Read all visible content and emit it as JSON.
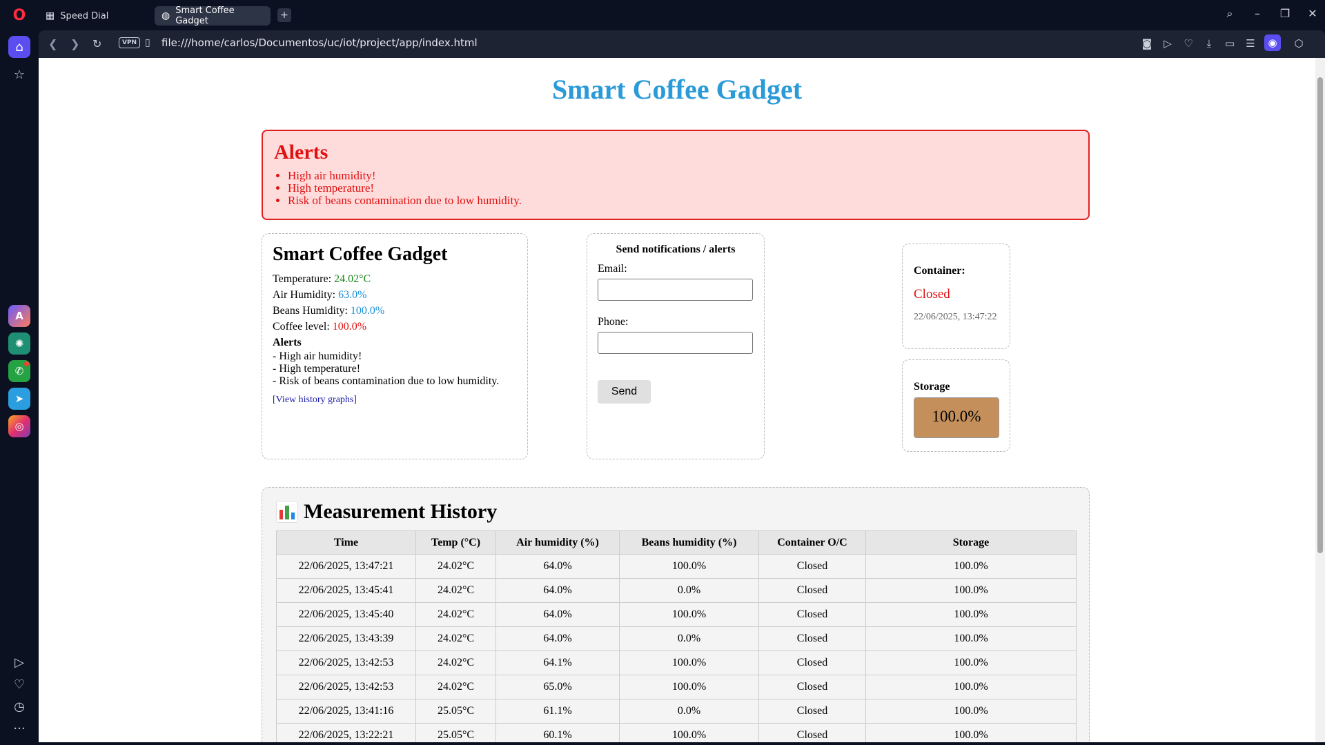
{
  "browser": {
    "tabs": [
      {
        "label": "Speed Dial"
      },
      {
        "label": "Smart Coffee Gadget"
      }
    ],
    "vpn_label": "VPN",
    "url": "file:///home/carlos/Documentos/uc/iot/project/app/index.html"
  },
  "page": {
    "title": "Smart Coffee Gadget",
    "alerts": {
      "heading": "Alerts",
      "items": [
        "High air humidity!",
        "High temperature!",
        "Risk of beans contamination due to low humidity."
      ]
    },
    "status": {
      "heading": "Smart Coffee Gadget",
      "temperature_label": "Temperature:",
      "temperature_value": "24.02°C",
      "air_humidity_label": "Air Humidity:",
      "air_humidity_value": "63.0%",
      "beans_humidity_label": "Beans Humidity:",
      "beans_humidity_value": "100.0%",
      "coffee_level_label": "Coffee level:",
      "coffee_level_value": "100.0%",
      "alerts_heading": "Alerts",
      "alerts": [
        "- High air humidity!",
        "- High temperature!",
        "- Risk of beans contamination due to low humidity."
      ],
      "history_link": "[View history graphs]"
    },
    "notify": {
      "heading": "Send notifications / alerts",
      "email_label": "Email:",
      "email_value": "",
      "phone_label": "Phone:",
      "phone_value": "",
      "send_label": "Send"
    },
    "container": {
      "label": "Container:",
      "state": "Closed",
      "timestamp": "22/06/2025, 13:47:22"
    },
    "storage": {
      "label": "Storage",
      "level_percent": 100,
      "level_text": "100.0%"
    },
    "history": {
      "heading": "Measurement History",
      "columns": [
        "Time",
        "Temp (°C)",
        "Air humidity (%)",
        "Beans humidity (%)",
        "Container O/C",
        "Storage"
      ],
      "rows": [
        [
          "22/06/2025, 13:47:21",
          "24.02°C",
          "64.0%",
          "100.0%",
          "Closed",
          "100.0%"
        ],
        [
          "22/06/2025, 13:45:41",
          "24.02°C",
          "64.0%",
          "0.0%",
          "Closed",
          "100.0%"
        ],
        [
          "22/06/2025, 13:45:40",
          "24.02°C",
          "64.0%",
          "100.0%",
          "Closed",
          "100.0%"
        ],
        [
          "22/06/2025, 13:43:39",
          "24.02°C",
          "64.0%",
          "0.0%",
          "Closed",
          "100.0%"
        ],
        [
          "22/06/2025, 13:42:53",
          "24.02°C",
          "64.1%",
          "100.0%",
          "Closed",
          "100.0%"
        ],
        [
          "22/06/2025, 13:42:53",
          "24.02°C",
          "65.0%",
          "100.0%",
          "Closed",
          "100.0%"
        ],
        [
          "22/06/2025, 13:41:16",
          "25.05°C",
          "61.1%",
          "0.0%",
          "Closed",
          "100.0%"
        ],
        [
          "22/06/2025, 13:22:21",
          "25.05°C",
          "60.1%",
          "100.0%",
          "Closed",
          "100.0%"
        ]
      ]
    }
  },
  "colors": {
    "title_blue": "#2a9bd8",
    "alert_red": "#e01010",
    "alert_bg": "#ffdcdc",
    "storage_fill": "#c48f5a",
    "accent_purple": "#5b4ef0"
  },
  "icons": {
    "sidebar": [
      "opera-logo",
      "home-icon",
      "pin-icon",
      "aria-icon",
      "chatgpt-icon",
      "whatsapp-icon",
      "telegram-icon",
      "instagram-icon",
      "player-icon",
      "heart-icon",
      "history-icon",
      "more-icon"
    ],
    "toolbar": [
      "back-icon",
      "forward-icon",
      "reload-icon",
      "file-icon",
      "camera-icon",
      "send-icon",
      "heart-icon",
      "download-icon",
      "battery-icon",
      "menu-icon",
      "profile-icon",
      "cube-icon"
    ]
  }
}
